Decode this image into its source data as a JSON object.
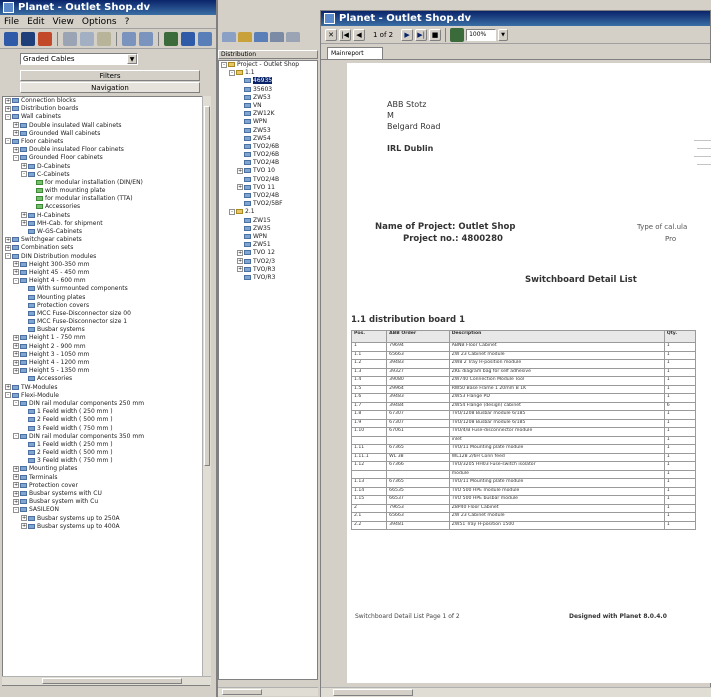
{
  "left_window": {
    "title": "Planet - Outlet Shop.dv",
    "menu": [
      "File",
      "Edit",
      "View",
      "Options",
      "?"
    ],
    "search_value": "Graded Cables",
    "panel_header": "Filters",
    "panel_tab": "Navigation",
    "tree": [
      {
        "label": "Connection blocks",
        "indent": 0,
        "exp": "+",
        "icon": "b"
      },
      {
        "label": "Distribution boards",
        "indent": 0,
        "exp": "+",
        "icon": "b"
      },
      {
        "label": "Wall cabinets",
        "indent": 0,
        "exp": "-",
        "icon": "b"
      },
      {
        "label": "Double insulated Wall cabinets",
        "indent": 1,
        "exp": "+",
        "icon": "b"
      },
      {
        "label": "Grounded Wall cabinets",
        "indent": 1,
        "exp": "+",
        "icon": "b"
      },
      {
        "label": "Floor cabinets",
        "indent": 0,
        "exp": "-",
        "icon": "b"
      },
      {
        "label": "Double insulated Floor cabinets",
        "indent": 1,
        "exp": "+",
        "icon": "b"
      },
      {
        "label": "Grounded Floor cabinets",
        "indent": 1,
        "exp": "-",
        "icon": "b"
      },
      {
        "label": "D-Cabinets",
        "indent": 2,
        "exp": "+",
        "icon": "b"
      },
      {
        "label": "C-Cabinets",
        "indent": 2,
        "exp": "-",
        "icon": "b"
      },
      {
        "label": "for modular installation (DIN/EN)",
        "indent": 3,
        "exp": "",
        "icon": "g"
      },
      {
        "label": "with mounting plate",
        "indent": 3,
        "exp": "",
        "icon": "g"
      },
      {
        "label": "for modular installation (TTA)",
        "indent": 3,
        "exp": "",
        "icon": "g"
      },
      {
        "label": "Accessories",
        "indent": 3,
        "exp": "",
        "icon": "g"
      },
      {
        "label": "H-Cabinets",
        "indent": 2,
        "exp": "+",
        "icon": "b"
      },
      {
        "label": "MH-Cab. for shipment",
        "indent": 2,
        "exp": "+",
        "icon": "b"
      },
      {
        "label": "W-GS-Cabinets",
        "indent": 2,
        "exp": "",
        "icon": "b"
      },
      {
        "label": "Switchgear cabinets",
        "indent": 0,
        "exp": "+",
        "icon": "b"
      },
      {
        "label": "Combination sets",
        "indent": 0,
        "exp": "+",
        "icon": "b"
      },
      {
        "label": "DIN Distribution modules",
        "indent": 0,
        "exp": "-",
        "icon": "b"
      },
      {
        "label": "Height 300-350 mm",
        "indent": 1,
        "exp": "+",
        "icon": "b"
      },
      {
        "label": "Height 45 - 450 mm",
        "indent": 1,
        "exp": "+",
        "icon": "b"
      },
      {
        "label": "Height 4 - 600 mm",
        "indent": 1,
        "exp": "-",
        "icon": "b"
      },
      {
        "label": "With surmounted components",
        "indent": 2,
        "exp": "",
        "icon": "b"
      },
      {
        "label": "Mounting plates",
        "indent": 2,
        "exp": "",
        "icon": "b"
      },
      {
        "label": "Protection covers",
        "indent": 2,
        "exp": "",
        "icon": "b"
      },
      {
        "label": "MCC Fuse-Disconnector size 00",
        "indent": 2,
        "exp": "",
        "icon": "b"
      },
      {
        "label": "MCC Fuse-Disconnector size 1",
        "indent": 2,
        "exp": "",
        "icon": "b"
      },
      {
        "label": "Busbar systems",
        "indent": 2,
        "exp": "",
        "icon": "b"
      },
      {
        "label": "Height 1 - 750 mm",
        "indent": 1,
        "exp": "+",
        "icon": "b"
      },
      {
        "label": "Height 2 - 900 mm",
        "indent": 1,
        "exp": "+",
        "icon": "b"
      },
      {
        "label": "Height 3 - 1050 mm",
        "indent": 1,
        "exp": "+",
        "icon": "b"
      },
      {
        "label": "Height 4 - 1200 mm",
        "indent": 1,
        "exp": "+",
        "icon": "b"
      },
      {
        "label": "Height 5 - 1350 mm",
        "indent": 1,
        "exp": "+",
        "icon": "b"
      },
      {
        "label": "Accessories",
        "indent": 2,
        "exp": "",
        "icon": "b"
      },
      {
        "label": "TW-Modules",
        "indent": 0,
        "exp": "+",
        "icon": "b"
      },
      {
        "label": "Flexi-Module",
        "indent": 0,
        "exp": "-",
        "icon": "b"
      },
      {
        "label": "DIN rail modular components 250 mm",
        "indent": 1,
        "exp": "-",
        "icon": "b"
      },
      {
        "label": "1 Feeld width ( 250 mm )",
        "indent": 2,
        "exp": "",
        "icon": "b"
      },
      {
        "label": "2 Feeld width ( 500 mm )",
        "indent": 2,
        "exp": "",
        "icon": "b"
      },
      {
        "label": "3 Feeld width ( 750 mm )",
        "indent": 2,
        "exp": "",
        "icon": "b"
      },
      {
        "label": "DIN rail modular components 350 mm",
        "indent": 1,
        "exp": "-",
        "icon": "b"
      },
      {
        "label": "1 Feeld width ( 250 mm )",
        "indent": 2,
        "exp": "",
        "icon": "b"
      },
      {
        "label": "2 Feeld width ( 500 mm )",
        "indent": 2,
        "exp": "",
        "icon": "b"
      },
      {
        "label": "3 Feeld width ( 750 mm )",
        "indent": 2,
        "exp": "",
        "icon": "b"
      },
      {
        "label": "Mounting plates",
        "indent": 1,
        "exp": "+",
        "icon": "b"
      },
      {
        "label": "Terminals",
        "indent": 1,
        "exp": "+",
        "icon": "b"
      },
      {
        "label": "Protection cover",
        "indent": 1,
        "exp": "+",
        "icon": "b"
      },
      {
        "label": "Busbar systems with CU",
        "indent": 1,
        "exp": "+",
        "icon": "b"
      },
      {
        "label": "Busbar system with Cu",
        "indent": 1,
        "exp": "+",
        "icon": "b"
      },
      {
        "label": "SASILEON",
        "indent": 1,
        "exp": "-",
        "icon": "b"
      },
      {
        "label": "Busbar systems up to 250A",
        "indent": 2,
        "exp": "+",
        "icon": "b"
      },
      {
        "label": "Busbar systems up to 400A",
        "indent": 2,
        "exp": "+",
        "icon": "b"
      }
    ]
  },
  "mid_panel": {
    "header": "Distribution",
    "tree": [
      {
        "label": "Project - Outlet Shop",
        "indent": 0,
        "exp": "-",
        "icon": "y",
        "sel": false
      },
      {
        "label": "1.1",
        "indent": 1,
        "exp": "-",
        "icon": "y",
        "sel": false
      },
      {
        "label": "46935",
        "indent": 2,
        "exp": "",
        "icon": "b",
        "sel": true
      },
      {
        "label": "35603",
        "indent": 2,
        "exp": "",
        "icon": "b",
        "sel": false
      },
      {
        "label": "ZW53",
        "indent": 2,
        "exp": "",
        "icon": "b",
        "sel": false
      },
      {
        "label": "VN",
        "indent": 2,
        "exp": "",
        "icon": "b",
        "sel": false
      },
      {
        "label": "ZW12K",
        "indent": 2,
        "exp": "",
        "icon": "b",
        "sel": false
      },
      {
        "label": "WPN",
        "indent": 2,
        "exp": "",
        "icon": "b",
        "sel": false
      },
      {
        "label": "ZW53",
        "indent": 2,
        "exp": "",
        "icon": "b",
        "sel": false
      },
      {
        "label": "ZW54",
        "indent": 2,
        "exp": "",
        "icon": "b",
        "sel": false
      },
      {
        "label": "TVO2/6B",
        "indent": 2,
        "exp": "",
        "icon": "b",
        "sel": false
      },
      {
        "label": "TVO2/6B",
        "indent": 2,
        "exp": "",
        "icon": "b",
        "sel": false
      },
      {
        "label": "TVO2/4B",
        "indent": 2,
        "exp": "",
        "icon": "b",
        "sel": false
      },
      {
        "label": "TVO 10",
        "indent": 2,
        "exp": "+",
        "icon": "b",
        "sel": false
      },
      {
        "label": "TVO2/4B",
        "indent": 2,
        "exp": "",
        "icon": "b",
        "sel": false
      },
      {
        "label": "TVO 11",
        "indent": 2,
        "exp": "+",
        "icon": "b",
        "sel": false
      },
      {
        "label": "TVO2/4B",
        "indent": 2,
        "exp": "",
        "icon": "b",
        "sel": false
      },
      {
        "label": "TVO2/5BF",
        "indent": 2,
        "exp": "",
        "icon": "b",
        "sel": false
      },
      {
        "label": "2.1",
        "indent": 1,
        "exp": "-",
        "icon": "y",
        "sel": false
      },
      {
        "label": "ZW15",
        "indent": 2,
        "exp": "",
        "icon": "b",
        "sel": false
      },
      {
        "label": "ZW35",
        "indent": 2,
        "exp": "",
        "icon": "b",
        "sel": false
      },
      {
        "label": "WPN",
        "indent": 2,
        "exp": "",
        "icon": "b",
        "sel": false
      },
      {
        "label": "ZW51",
        "indent": 2,
        "exp": "",
        "icon": "b",
        "sel": false
      },
      {
        "label": "TVO 12",
        "indent": 2,
        "exp": "+",
        "icon": "b",
        "sel": false
      },
      {
        "label": "TVO2/3",
        "indent": 2,
        "exp": "+",
        "icon": "b",
        "sel": false
      },
      {
        "label": "TVO/R3",
        "indent": 2,
        "exp": "+",
        "icon": "b",
        "sel": false
      },
      {
        "label": "TVO/R3",
        "indent": 2,
        "exp": "",
        "icon": "b",
        "sel": false
      }
    ]
  },
  "report_window": {
    "title": "Planet - Outlet Shop.dv",
    "page_indicator": "1 of 2",
    "zoom": "100%",
    "tab": "Mainreport",
    "address_lines": [
      "ABB Stotz",
      "M",
      "Belgard Road",
      "",
      "IRL Dublin"
    ],
    "project_name_label": "Name of Project:",
    "project_name_value": "Outlet Shop",
    "project_no_label": "Project no.:",
    "project_no_value": "4800280",
    "right_label_1": "Type of cal.ula",
    "right_label_2": "Pro",
    "doc_title": "Switchboard Detail List",
    "section_title": "1.1 distribution board 1",
    "columns": [
      "Pos.",
      "ABB Order",
      "Description",
      "Qty."
    ],
    "rows": [
      [
        "1",
        "79694",
        "ABNB Floor Cabinet",
        "1"
      ],
      [
        "1.1",
        "65663",
        "ZW 23 Cabinet module",
        "1"
      ],
      [
        "1.2",
        "39483",
        "ZW8 2 Tray H-position module",
        "1"
      ],
      [
        "1.3",
        "39327",
        "ZKE diagram bag for self adhesive",
        "1"
      ],
      [
        "1.4",
        "39080",
        "ZW740 Connection Module Tool",
        "1"
      ],
      [
        "1.5",
        "29964",
        "RW50 Base Frame 1 20mm B 1K",
        "1"
      ],
      [
        "1.6",
        "39483",
        "ZW53 Flange PD",
        "1"
      ],
      [
        "1.7",
        "39484",
        "ZW54 Flange (design) cabinet",
        "6"
      ],
      [
        "1.8",
        "67307",
        "TVO/1208 Busbar module 6/185",
        "1"
      ],
      [
        "1.9",
        "67307",
        "TVO/1208 Busbar module 6/185",
        "1"
      ],
      [
        "1.10",
        "67061",
        "TVO/4/B Fuse-disconnector module",
        "1"
      ],
      [
        "",
        "",
        "inlet",
        "1"
      ],
      [
        "1.11",
        "67365",
        "TVO/11 Mounting plate module",
        "1"
      ],
      [
        "1.11.1",
        "WL 38",
        "WL128 2/6H Conn feed",
        "1"
      ],
      [
        "1.12",
        "67366",
        "TVO/3205 HH03 Fuse-switch isolator",
        "1"
      ],
      [
        "",
        "",
        "module",
        "1"
      ],
      [
        "1.13",
        "67365",
        "TVO/11 Mounting plate module",
        "1"
      ],
      [
        "1.14",
        "66535",
        "TVO 500 HPE module module",
        "1"
      ],
      [
        "1.15",
        "66537",
        "TVO 500 HPE busbar module",
        "1"
      ],
      [
        "2",
        "79653",
        "Z8P40 Floor Cabinet",
        "1"
      ],
      [
        "2.1",
        "65663",
        "ZW 23 Cabinet module",
        "1"
      ],
      [
        "2.2",
        "39481",
        "ZW51 Tray H-position 1500",
        "1"
      ]
    ],
    "footer_left": "Switchboard Detail List Page 1 of 2",
    "footer_right": "Designed with Planet 8.0.4.0"
  }
}
